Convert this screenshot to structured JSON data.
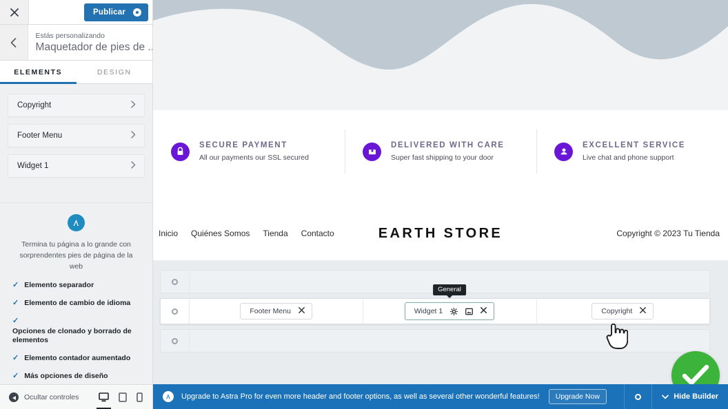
{
  "sidebar": {
    "close_icon": "close-icon",
    "publish_label": "Publicar",
    "eyebrow": "Estás personalizando",
    "title": "Maquetador de pies de ...",
    "tabs": [
      {
        "label": "ELEMENTS",
        "active": true
      },
      {
        "label": "DESIGN",
        "active": false
      }
    ],
    "elements": [
      {
        "label": "Copyright"
      },
      {
        "label": "Footer Menu"
      },
      {
        "label": "Widget 1"
      }
    ],
    "promo": {
      "logo_text": "A",
      "headline": "Termina tu página a lo grande con sorprendentes pies de página de la web",
      "features": [
        "Elemento separador",
        "Elemento de cambio de idioma",
        "Opciones de clonado y borrado de elementos",
        "Elemento contador aumentado",
        "Más opciones de diseño"
      ]
    },
    "footer": {
      "hide_controls_label": "Ocultar controles",
      "devices": [
        {
          "name": "desktop-icon",
          "active": true
        },
        {
          "name": "tablet-icon",
          "active": false
        },
        {
          "name": "mobile-icon",
          "active": false
        }
      ]
    }
  },
  "preview": {
    "features": [
      {
        "icon": "lock-icon",
        "title": "SECURE PAYMENT",
        "subtitle": "All our payments our SSL secured"
      },
      {
        "icon": "box-icon",
        "title": "DELIVERED WITH CARE",
        "subtitle": "Super fast shipping to your door"
      },
      {
        "icon": "support-icon",
        "title": "EXCELLENT SERVICE",
        "subtitle": "Live chat and phone support"
      }
    ],
    "nav": {
      "links": [
        "Inicio",
        "Quiénes Somos",
        "Tienda",
        "Contacto"
      ],
      "brand": "EARTH STORE",
      "copyright": "Copyright © 2023 Tu Tienda"
    },
    "builder": {
      "rows": [
        {
          "name": "above-footer-row",
          "active": false,
          "chips": []
        },
        {
          "name": "primary-footer-row",
          "active": true,
          "chips": [
            {
              "label": "Footer Menu",
              "column": 1,
              "selected": false,
              "tooltip": ""
            },
            {
              "label": "Widget 1",
              "column": 2,
              "selected": true,
              "tooltip": "General"
            },
            {
              "label": "Copyright",
              "column": 3,
              "selected": false,
              "tooltip": ""
            }
          ]
        },
        {
          "name": "below-footer-row",
          "active": false,
          "chips": []
        }
      ]
    }
  },
  "bottom_bar": {
    "badge": "A",
    "message": "Upgrade to Astra Pro for even more header and footer options, as well as several other wonderful features!",
    "upgrade_label": "Upgrade Now",
    "hide_builder_label": "Hide Builder"
  },
  "colors": {
    "publish_blue": "#2271b1",
    "bottom_bar_blue": "#1b72b8",
    "feature_purple": "#6a16d6",
    "success_green": "#3cb43c",
    "tab_underline": "#2271b1"
  }
}
